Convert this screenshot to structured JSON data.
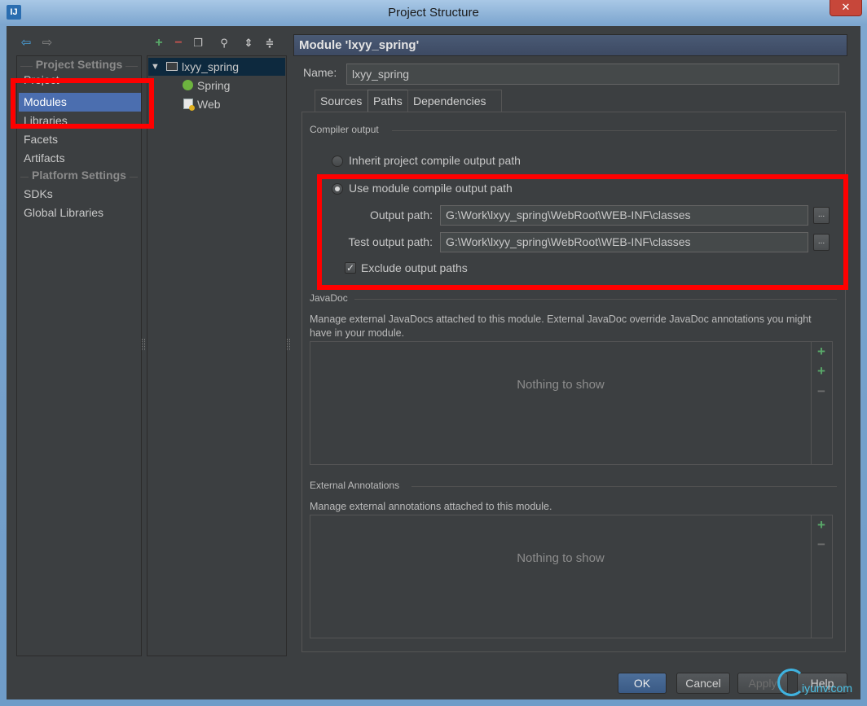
{
  "window": {
    "title": "Project Structure",
    "logo_text": "IJ",
    "close_glyph": "✕"
  },
  "nav": {
    "back_icon": "back-arrow-icon",
    "forward_icon": "forward-arrow-icon",
    "sections": [
      {
        "title": "Project Settings",
        "items": [
          "Project",
          "Modules",
          "Libraries",
          "Facets",
          "Artifacts"
        ]
      },
      {
        "title": "Platform Settings",
        "items": [
          "SDKs",
          "Global Libraries"
        ]
      }
    ],
    "selected": "Modules"
  },
  "tree_toolbar": {
    "icons": [
      "add-icon",
      "remove-icon",
      "copy-icon",
      "find-icon",
      "expand-all-icon",
      "collapse-all-icon"
    ]
  },
  "tree": {
    "root": "lxyy_spring",
    "children": [
      "Spring",
      "Web"
    ]
  },
  "module": {
    "header": "Module 'lxyy_spring'",
    "name_label": "Name:",
    "name_value": "lxyy_spring",
    "tabs": [
      "Sources",
      "Paths",
      "Dependencies"
    ],
    "active_tab": "Paths"
  },
  "compiler_output": {
    "group_title": "Compiler output",
    "inherit_label": "Inherit project compile output path",
    "use_module_label": "Use module compile output path",
    "selected": "use_module",
    "output_path_label": "Output path:",
    "output_path_value": "G:\\Work\\lxyy_spring\\WebRoot\\WEB-INF\\classes",
    "test_output_path_label": "Test output path:",
    "test_output_path_value": "G:\\Work\\lxyy_spring\\WebRoot\\WEB-INF\\classes",
    "browse_label": "...",
    "exclude_label": "Exclude output paths",
    "exclude_checked": true
  },
  "javadoc": {
    "group_title": "JavaDoc",
    "description": "Manage external JavaDocs attached to this module. External JavaDoc override JavaDoc annotations you might have in your module.",
    "empty_text": "Nothing to show"
  },
  "annotations": {
    "group_title": "External Annotations",
    "description": "Manage external annotations attached to this module.",
    "empty_text": "Nothing to show"
  },
  "footer": {
    "ok": "OK",
    "cancel": "Cancel",
    "apply": "Apply",
    "help": "Help"
  },
  "watermark": "iyunv.com",
  "colors": {
    "background": "#3c3f41",
    "selection": "#4b6eaf",
    "highlight_box": "#ff0000",
    "add_icon": "#59a869",
    "remove_icon": "#c75450"
  }
}
